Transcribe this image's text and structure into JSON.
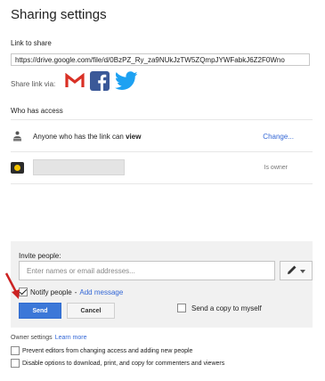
{
  "title": "Sharing settings",
  "link": {
    "label": "Link to share",
    "value": "https://drive.google.com/file/d/0BzPZ_Ry_za9NUkJzTW5ZQmpJYWFabkJ6Z2F0Wno",
    "share_via_label": "Share link via:",
    "share_icons": [
      "gmail-icon",
      "facebook-icon",
      "twitter-icon"
    ]
  },
  "access": {
    "label": "Who has access",
    "rows": [
      {
        "icon": "globe-person-icon",
        "text_prefix": "Anyone who has the link can",
        "permission": "view",
        "action": "Change..."
      },
      {
        "icon": "avatar",
        "role": "Is owner"
      }
    ]
  },
  "invite": {
    "label": "Invite people:",
    "placeholder": "Enter names or email addresses...",
    "notify_label": "Notify people",
    "notify_separator": "-",
    "notify_checked": true,
    "add_message": "Add message",
    "send_label": "Send",
    "cancel_label": "Cancel",
    "copy_label": "Send a copy to myself",
    "copy_checked": false
  },
  "owner_settings": {
    "label": "Owner settings",
    "learn_more": "Learn more",
    "options": [
      {
        "label": "Prevent editors from changing access and adding new people",
        "checked": false
      },
      {
        "label": "Disable options to download, print, and copy for commenters and viewers",
        "checked": false
      }
    ]
  },
  "colors": {
    "accent": "#3c78d8",
    "link": "#3367d6",
    "annotation_arrow": "#cc2222",
    "gmail_red": "#d93025",
    "facebook_blue": "#3b5998",
    "twitter_blue": "#1da1f2"
  }
}
